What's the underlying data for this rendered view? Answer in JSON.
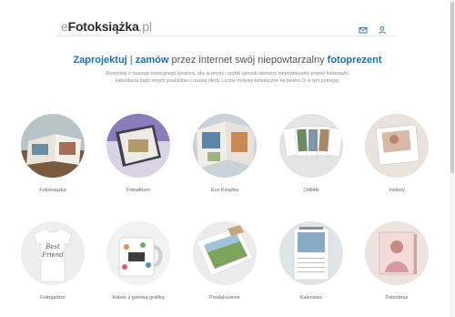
{
  "header": {
    "logo_prefix": "e",
    "logo_main": "Fotoksiążka",
    "logo_suffix": ".pl",
    "icons": [
      "mail-icon",
      "user-icon"
    ]
  },
  "hero": {
    "headline_part1": "Zaprojektuj",
    "headline_sep": " | ",
    "headline_part2": "zamów",
    "headline_part3": " przez internet swój niepowtarzalny ",
    "headline_part4": "fotoprezent",
    "description": "Skorzystaj z naszego intuicyjnego kreatora, aby w prosty i szybki sposób stworzyć niepowtarzalny projekt fotoksiążki, kalendarza bądź innych produktów z naszej oferty. Liczne motywy tematyczne na pewno Ci w tym pomogą."
  },
  "products": [
    {
      "label": "Fotoksiążka"
    },
    {
      "label": "Fotoalbum"
    },
    {
      "label": "Eco Książka"
    },
    {
      "label": "Odbitki"
    },
    {
      "label": "Instaxy"
    },
    {
      "label": "Fotogadżet"
    },
    {
      "label": "Kubek z gotową grafiką"
    },
    {
      "label": "Powiększenie"
    },
    {
      "label": "Kalendarz"
    },
    {
      "label": "Fotoobraz"
    }
  ],
  "colors": {
    "accent": "#1a6fb5",
    "logo_dark": "#2b2b2b",
    "text_muted": "#8a8a8a"
  }
}
